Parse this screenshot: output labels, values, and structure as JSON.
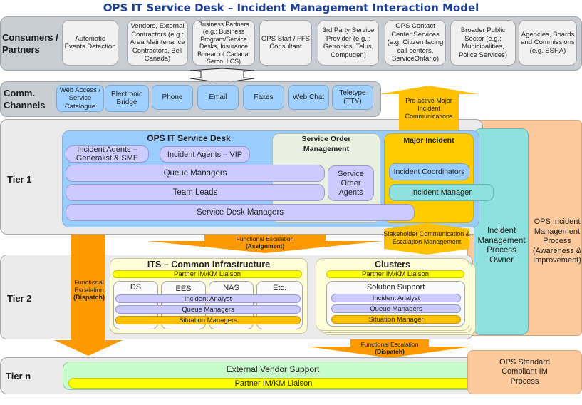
{
  "title": "OPS IT Service Desk – Incident Management Interaction Model",
  "colors": {
    "title": "#1f3f8f",
    "channel": "#9fd0ff",
    "service_desk": "#99ccff",
    "role": "#cccbff",
    "major_incident": "#ffcc00",
    "process_owner": "#8fe0de",
    "process": "#fcc99c",
    "liaison": "#ffff00",
    "situation": "#ffc000",
    "escalation_arrow": "#ff9900",
    "vendor": "#c8fbcc"
  },
  "consumers": {
    "label": "Consumers / Partners",
    "items": [
      "Automatic Events Detection",
      "Vendors, External Contractors (e.g.: Area Maintenance Contractors, Bell Canada)",
      "Business Partners (e.g.: Business Program/Service Desks, Insurance Bureau of Canada, Serco, LCS)",
      "OPS Staff / FFS Consultant",
      "3rd Party Service Provider (e.g..: Getronics, Telus, Compugen)",
      "OPS Contact Center Services (e.g. Citizen facing call centers, ServiceOntario)",
      "Broader Public Sector (e.g.: Municipalities, Police Services)",
      "Agencies, Boards and Commissions (e.g. SSHA)"
    ]
  },
  "channels": {
    "label": "Comm. Channels",
    "items": [
      "Web Access / Service Catalogue",
      "Electronic Bridge",
      "Phone",
      "Email",
      "Faxes",
      "Web Chat",
      "Teletype (TTY)"
    ]
  },
  "proactive_arrow": "Pro-active Major Incident Communications",
  "tier1": {
    "label": "Tier 1",
    "service_desk": {
      "title": "OPS IT Service Desk",
      "agents_generalist": "Incident Agents – Generalist & SME",
      "agents_vip": "Incident Agents – VIP",
      "queue_managers": "Queue Managers",
      "team_leads": "Team Leads",
      "managers": "Service Desk Managers"
    },
    "service_order": {
      "title": "Service Order Management",
      "agents": "Service Order Agents"
    },
    "major_incident": {
      "title": "Major Incident",
      "coordinators": "Incident Coordinators",
      "manager": "Incident Manager"
    }
  },
  "assignment_arrow": {
    "line1": "Functional Escalation",
    "line2": "(Assignment)"
  },
  "stakeholder_arrow": "Stakeholder Communication & Escalation Management",
  "dispatch_left": {
    "line1": "Functional Escalation",
    "line2": "(Dispatch)"
  },
  "process_owner": "Incident Management Process Owner",
  "ops_process": "OPS Incident Management Process (Awareness & Improvement)",
  "tier2": {
    "label": "Tier 2",
    "its": {
      "title": "ITS – Common Infrastructure",
      "liaison": "Partner IM/KM Liaison",
      "groups": [
        "DS",
        "EES",
        "NAS",
        "Etc."
      ],
      "incident_analyst": "Incident Analyst",
      "queue_managers": "Queue Managers",
      "situation": "Situation Managers"
    },
    "clusters": {
      "title": "Clusters",
      "liaison": "Partner IM/KM Liaison",
      "solution_support": "Solution Support",
      "incident_analyst": "Incident Analyst",
      "queue_managers": "Queue Managers",
      "situation": "Situation Manager"
    }
  },
  "dispatch_bottom": {
    "line1": "Functional Escalation",
    "line2": "(Dispatch)"
  },
  "tiern": {
    "label": "Tier n",
    "vendor": "External Vendor Support",
    "liaison": "Partner IM/KM Liaison"
  },
  "ops_standard": "OPS Standard Compliant IM Process"
}
